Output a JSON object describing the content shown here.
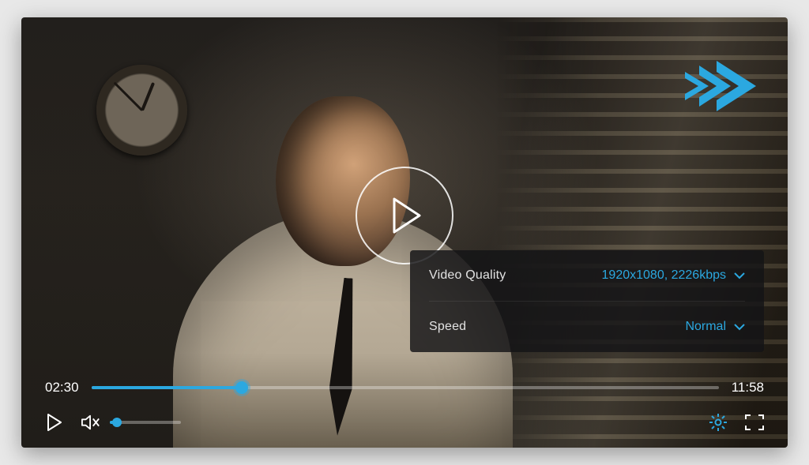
{
  "colors": {
    "accent": "#2ba8e0"
  },
  "logo": "forward-double-arrow",
  "play_center": "play",
  "settings": {
    "rows": [
      {
        "label": "Video Quality",
        "value": "1920x1080, 2226kbps"
      },
      {
        "label": "Speed",
        "value": "Normal"
      }
    ]
  },
  "progress": {
    "current": "02:30",
    "duration": "11:58",
    "pct": 24
  },
  "volume": {
    "muted": true,
    "pct": 10
  },
  "controls": {
    "play": "play",
    "mute": "mute",
    "settings": "settings",
    "fullscreen": "fullscreen"
  }
}
